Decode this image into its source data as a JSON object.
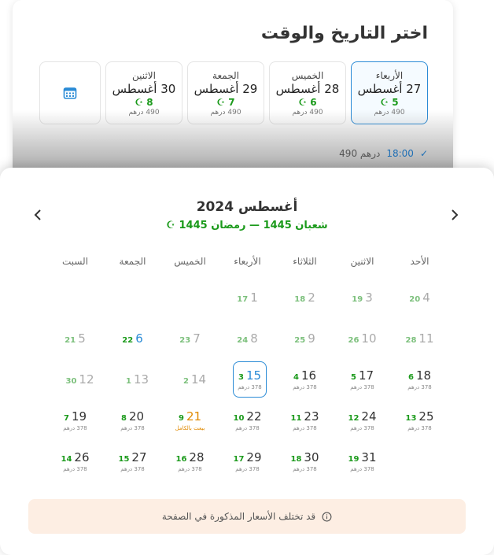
{
  "header": {
    "title": "اختر التاريخ والوقت"
  },
  "day_cards": [
    {
      "name": "الأربعاء",
      "date": "27 أغسطس",
      "hijri": "5",
      "price": "490 درهم",
      "selected": true
    },
    {
      "name": "الخميس",
      "date": "28 أغسطس",
      "hijri": "6",
      "price": "490 درهم",
      "selected": false
    },
    {
      "name": "الجمعة",
      "date": "29 أغسطس",
      "hijri": "7",
      "price": "490 درهم",
      "selected": false
    },
    {
      "name": "الاثنين",
      "date": "30 أغسطس",
      "hijri": "8",
      "price": "490 درهم",
      "selected": false
    }
  ],
  "time_slot": {
    "time": "18:00",
    "price": "490 درهم"
  },
  "calendar": {
    "month_title": "أغسطس 2024",
    "hijri_range": "شعبان 1445 — رمضان 1445",
    "weekdays": [
      "الأحد",
      "الاثنين",
      "الثلاثاء",
      "الأربعاء",
      "الخميس",
      "الجمعة",
      "السبت"
    ],
    "weeks": [
      [
        {
          "g": "4",
          "h": "20",
          "past": true
        },
        {
          "g": "3",
          "h": "19",
          "past": true
        },
        {
          "g": "2",
          "h": "18",
          "past": true
        },
        {
          "g": "1",
          "h": "17",
          "past": true
        },
        null,
        null,
        null
      ],
      [
        {
          "g": "11",
          "h": "28",
          "past": true
        },
        {
          "g": "10",
          "h": "26",
          "past": true
        },
        {
          "g": "9",
          "h": "25",
          "past": true
        },
        {
          "g": "8",
          "h": "24",
          "past": true
        },
        {
          "g": "7",
          "h": "23",
          "past": true
        },
        {
          "g": "6",
          "h": "22",
          "blue": true
        },
        {
          "g": "5",
          "h": "21",
          "past": true
        }
      ],
      [
        {
          "g": "18",
          "h": "6",
          "p": "378 درهم"
        },
        {
          "g": "17",
          "h": "5",
          "p": "378 درهم"
        },
        {
          "g": "16",
          "h": "4",
          "p": "378 درهم"
        },
        {
          "g": "15",
          "h": "3",
          "p": "378 درهم",
          "sel": true
        },
        {
          "g": "14",
          "h": "2",
          "past": true
        },
        {
          "g": "13",
          "h": "1",
          "past": true
        },
        {
          "g": "12",
          "h": "30",
          "past": true
        }
      ],
      [
        {
          "g": "25",
          "h": "13",
          "p": "378 درهم"
        },
        {
          "g": "24",
          "h": "12",
          "p": "378 درهم"
        },
        {
          "g": "23",
          "h": "11",
          "p": "378 درهم"
        },
        {
          "g": "22",
          "h": "10",
          "p": "378 درهم"
        },
        {
          "g": "21",
          "h": "9",
          "p": "بيعت بالكامل",
          "soldout": true
        },
        {
          "g": "20",
          "h": "8",
          "p": "378 درهم"
        },
        {
          "g": "19",
          "h": "7",
          "p": "378 درهم"
        }
      ],
      [
        null,
        {
          "g": "31",
          "h": "19",
          "p": "378 درهم"
        },
        {
          "g": "30",
          "h": "18",
          "p": "378 درهم"
        },
        {
          "g": "29",
          "h": "17",
          "p": "378 درهم"
        },
        {
          "g": "28",
          "h": "16",
          "p": "378 درهم"
        },
        {
          "g": "27",
          "h": "15",
          "p": "378 درهم"
        },
        {
          "g": "26",
          "h": "14",
          "p": "378 درهم"
        }
      ]
    ]
  },
  "notice": {
    "text": "قد تختلف الأسعار المذكورة في الصفحة"
  },
  "colors": {
    "accent": "#2a8bd6",
    "hijri": "#1b9a1b",
    "soldout": "#e08a00",
    "notice_bg": "#fdeee3"
  }
}
